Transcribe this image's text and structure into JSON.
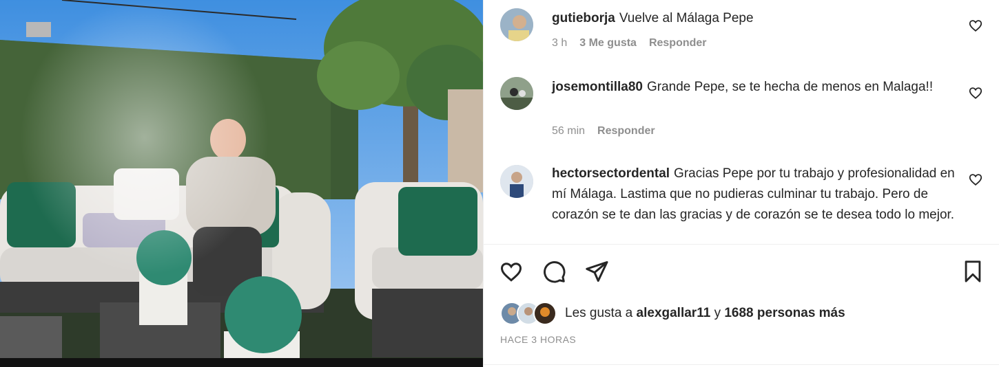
{
  "post": {
    "image_alt": "man-sitting-on-terrace-sofa-photo"
  },
  "comments": [
    {
      "username": "gutieborja",
      "text": "Vuelve al Málaga Pepe",
      "time": "3 h",
      "likes": "3 Me gusta",
      "reply": "Responder"
    },
    {
      "username": "josemontilla80",
      "text": "Grande Pepe, se te hecha de menos en Malaga!!",
      "time": "56 min",
      "reply": "Responder"
    },
    {
      "username": "hectorsectordental",
      "text": "Gracias Pepe por tu trabajo y profesionalidad en mí Málaga. Lastima que no pudieras culminar tu trabajo. Pero de corazón se te dan las gracias y de corazón se te desea todo lo mejor."
    }
  ],
  "actions": {
    "like_icon": "heart-icon",
    "comment_icon": "comment-icon",
    "share_icon": "send-icon",
    "save_icon": "bookmark-icon"
  },
  "likes": {
    "prefix": "Les gusta a",
    "user": "alexgallar11",
    "connector": "y",
    "others": "1688 personas más"
  },
  "timestamp": "HACE 3 HORAS",
  "colors": {
    "text": "#262626",
    "muted": "#8e8e8e",
    "divider": "#efefef"
  }
}
